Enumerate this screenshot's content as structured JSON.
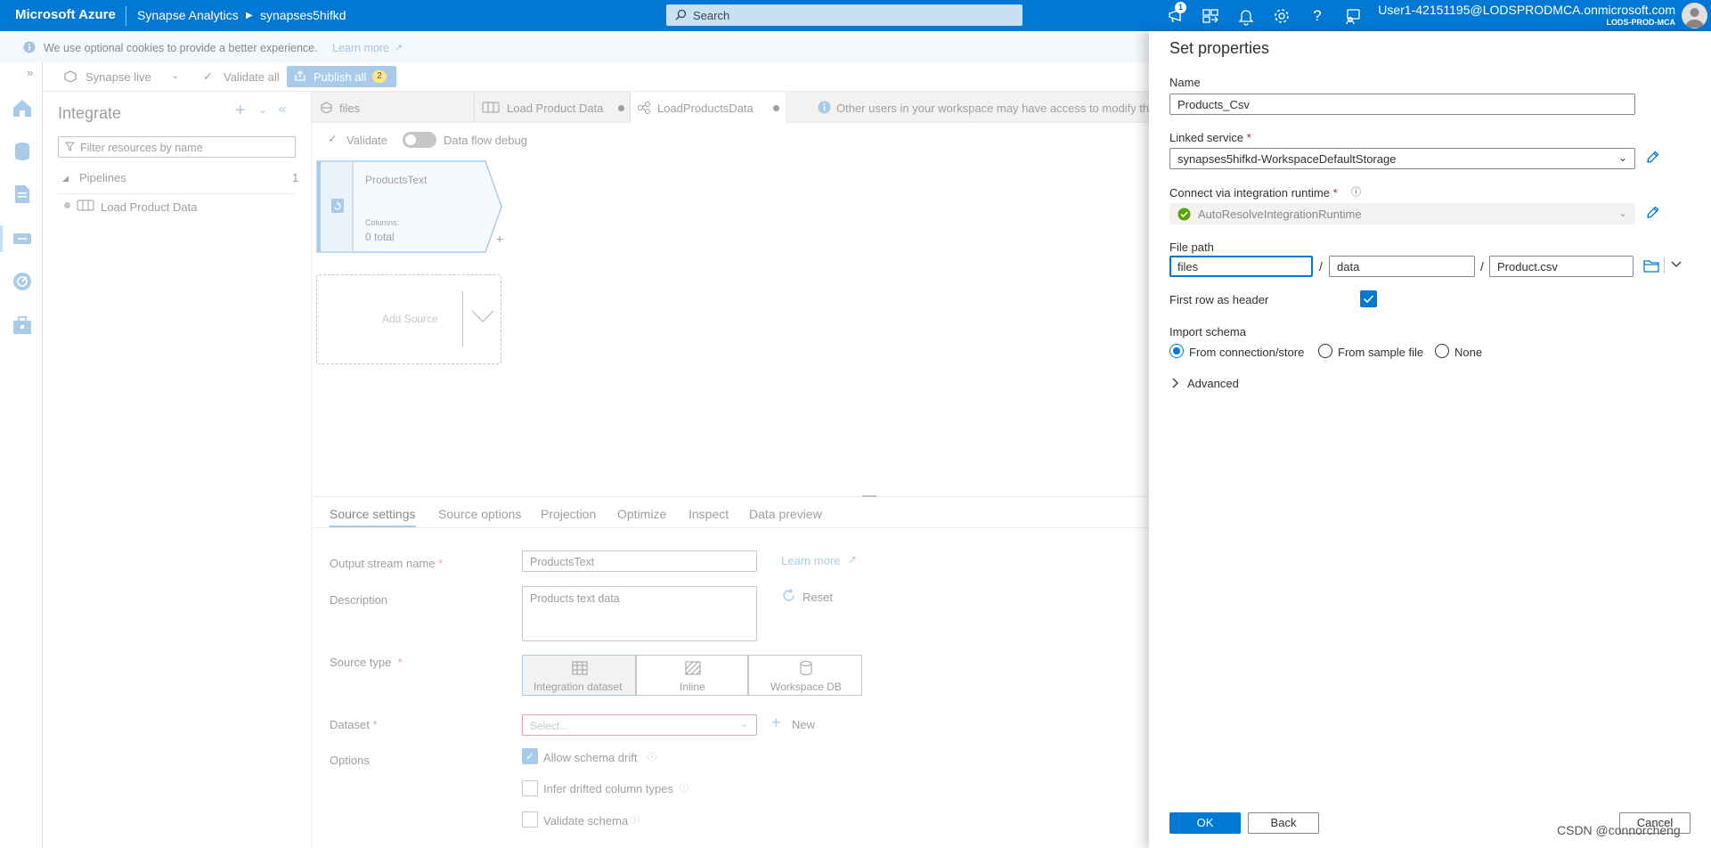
{
  "topbar": {
    "brand": "Microsoft Azure",
    "service": "Synapse Analytics",
    "workspace": "synapses5hifkd",
    "search_placeholder": "Search",
    "notification_count": "1",
    "user_email": "User1-42151195@LODSPRODMCA.onmicrosoft.com",
    "user_tenant": "LODS-PROD-MCA"
  },
  "cookie_bar": {
    "message": "We use optional cookies to provide a better experience.",
    "link": "Learn more"
  },
  "toolbar": {
    "mode": "Synapse live",
    "validate_all": "Validate all",
    "publish_all": "Publish all",
    "publish_count": "2"
  },
  "integrate": {
    "title": "Integrate",
    "filter_placeholder": "Filter resources by name",
    "section": "Pipelines",
    "section_count": "1",
    "items": [
      "Load Product Data"
    ]
  },
  "tabs": [
    {
      "label": "files"
    },
    {
      "label": "Load Product Data"
    },
    {
      "label": "LoadProductsData"
    }
  ],
  "info_banner": "Other users in your workspace may have access to modify th",
  "canvas_toolbar": {
    "validate": "Validate",
    "debug": "Data flow debug"
  },
  "source_node": {
    "name": "ProductsText",
    "columns_label": "Columns:",
    "columns_value": "0 total",
    "add_source": "Add Source"
  },
  "bottom_tabs": [
    "Source settings",
    "Source options",
    "Projection",
    "Optimize",
    "Inspect",
    "Data preview"
  ],
  "source_settings": {
    "output_stream_label": "Output stream name",
    "output_stream_value": "ProductsText",
    "learn_more": "Learn more",
    "description_label": "Description",
    "description_value": "Products text data",
    "reset": "Reset",
    "source_type_label": "Source type",
    "source_types": [
      "Integration dataset",
      "Inline",
      "Workspace DB"
    ],
    "dataset_label": "Dataset",
    "dataset_placeholder": "Select...",
    "new": "New",
    "options_label": "Options",
    "options": [
      "Allow schema drift",
      "Infer drifted column types",
      "Validate schema"
    ]
  },
  "panel": {
    "title": "Set properties",
    "name_label": "Name",
    "name_value": "Products_Csv",
    "linked_service_label": "Linked service",
    "linked_service_value": "synapses5hifkd-WorkspaceDefaultStorage",
    "runtime_label": "Connect via integration runtime",
    "runtime_value": "AutoResolveIntegrationRuntime",
    "file_path_label": "File path",
    "file_path": [
      "files",
      "data",
      "Product.csv"
    ],
    "first_row_header_label": "First row as header",
    "first_row_header_checked": true,
    "import_schema_label": "Import schema",
    "import_schema_options": [
      "From connection/store",
      "From sample file",
      "None"
    ],
    "import_schema_selected": "From connection/store",
    "advanced": "Advanced",
    "ok": "OK",
    "back": "Back",
    "cancel": "Cancel"
  },
  "watermark": "CSDN @connorcheng",
  "colors": {
    "accent": "#0078d4",
    "topbar": "#0078d4",
    "success": "#57a300"
  }
}
